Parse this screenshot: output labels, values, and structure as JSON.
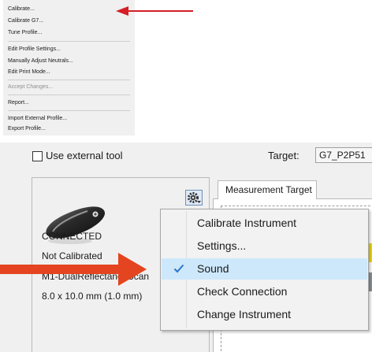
{
  "profile_menu": {
    "items": [
      {
        "label": "Calibrate...",
        "enabled": true
      },
      {
        "label": "Calibrate G7...",
        "enabled": true
      },
      {
        "label": "Tune Profile...",
        "enabled": true
      },
      {
        "label": "Edit Profile Settings...",
        "enabled": true
      },
      {
        "label": "Manually Adjust Neutrals...",
        "enabled": true
      },
      {
        "label": "Edit Print Mode...",
        "enabled": true
      },
      {
        "label": "Accept Changes...",
        "enabled": false
      },
      {
        "label": "Report...",
        "enabled": true
      },
      {
        "label": "Import External Profile...",
        "enabled": true
      },
      {
        "label": "Export Profile...",
        "enabled": true
      }
    ]
  },
  "options": {
    "external_tool_label": "Use external tool",
    "external_tool_checked": false,
    "target_label": "Target:",
    "target_value": "G7_P2P51"
  },
  "instrument": {
    "status": "CONNECTED",
    "calibration": "Not Calibrated",
    "model": "M1-DualReflectanceScan",
    "aperture": "8.0 x 10.0 mm (1.0 mm)"
  },
  "tabs": [
    {
      "label": "Measurement Target",
      "active": true
    }
  ],
  "instrument_menu": {
    "items": [
      {
        "label": "Calibrate Instrument",
        "checked": false
      },
      {
        "label": "Settings...",
        "checked": false
      },
      {
        "label": "Sound",
        "checked": true
      },
      {
        "label": "Check Connection",
        "checked": false
      },
      {
        "label": "Change Instrument",
        "checked": false
      }
    ]
  },
  "colors": {
    "accent_arrow": "#d41f26",
    "checked_highlight": "#cde8fb",
    "check_mark": "#2e74c8",
    "swatch_yellow": "#f3d800",
    "swatch_gray": "#8c9198"
  },
  "icons": {
    "gear": "gear-icon",
    "instrument": "spectrophotometer-icon",
    "check": "checkmark-icon"
  }
}
